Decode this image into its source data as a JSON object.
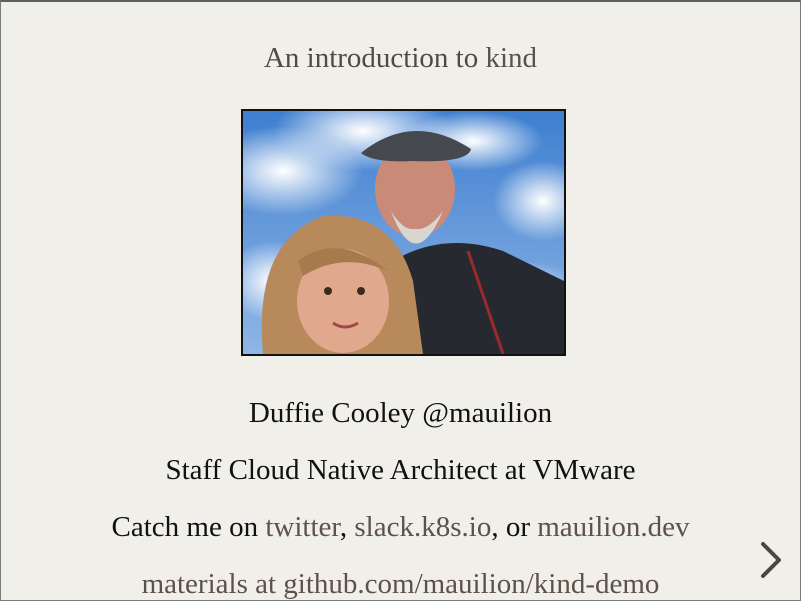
{
  "slide": {
    "title_prefix": "An introduction to ",
    "title_link": "kind",
    "name_line": "Duffie Cooley @mauilion",
    "role_line": "Staff Cloud Native Architect at VMware",
    "contact": {
      "prefix": "Catch me on ",
      "twitter": "twitter",
      "sep1": ", ",
      "slack": "slack.k8s.io",
      "sep2": ", or ",
      "site": "mauilion.dev"
    },
    "materials": "materials at github.com/mauilion/kind-demo"
  },
  "nav": {
    "next_icon": "chevron-right-icon"
  },
  "colors": {
    "background": "#f0efea",
    "link": "#5e5248",
    "text": "#111111"
  }
}
